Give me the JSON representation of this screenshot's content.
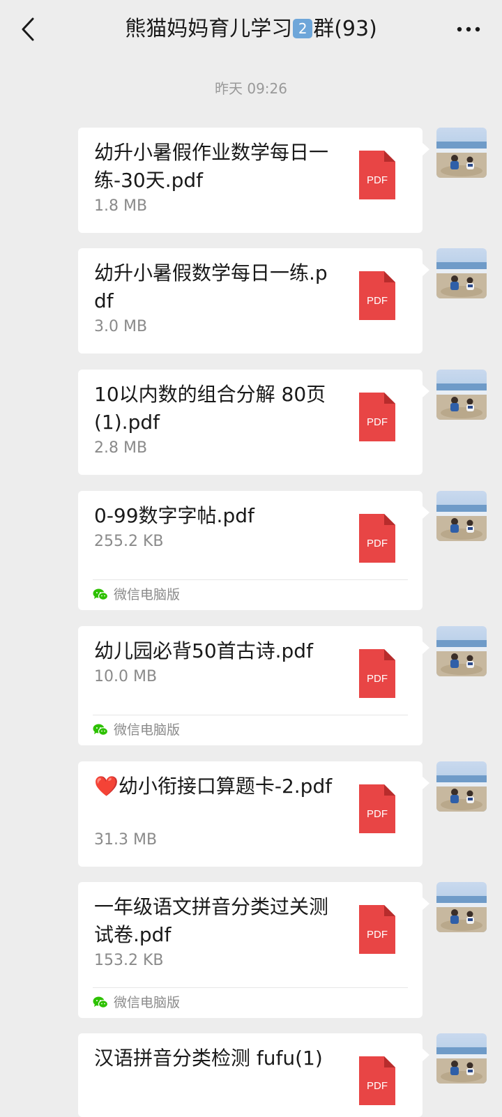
{
  "header": {
    "title_prefix": "熊猫妈妈育儿学习",
    "title_badge": "2",
    "title_suffix": "群(93)"
  },
  "timestamp": "昨天 09:26",
  "icons": {
    "back": "chevron-left-icon",
    "more": "more-icon",
    "file": "pdf-file-icon",
    "source": "wechat-icon"
  },
  "colors": {
    "pdf_red": "#e84545",
    "wechat_green": "#2dc100"
  },
  "messages": [
    {
      "name": "幼升小暑假作业数学每日一练-30天.pdf",
      "size": "1.8 MB",
      "icon_label": "PDF",
      "source": ""
    },
    {
      "name": "幼升小暑假数学每日一练.pdf",
      "size": "3.0 MB",
      "icon_label": "PDF",
      "source": ""
    },
    {
      "name": "10以内数的组合分解 80页(1).pdf",
      "size": "2.8 MB",
      "icon_label": "PDF",
      "source": ""
    },
    {
      "name": "0-99数字字帖.pdf",
      "size": "255.2 KB",
      "icon_label": "PDF",
      "source": "微信电脑版"
    },
    {
      "name": "幼儿园必背50首古诗.pdf",
      "size": "10.0 MB",
      "icon_label": "PDF",
      "source": "微信电脑版"
    },
    {
      "name": "❤️幼小衔接口算题卡-2.pdf",
      "size": "31.3 MB",
      "icon_label": "PDF",
      "source": ""
    },
    {
      "name": "一年级语文拼音分类过关测试卷.pdf",
      "size": "153.2 KB",
      "icon_label": "PDF",
      "source": "微信电脑版"
    },
    {
      "name": "汉语拼音分类检测 fufu(1)",
      "size": "",
      "icon_label": "PDF",
      "source": ""
    }
  ]
}
